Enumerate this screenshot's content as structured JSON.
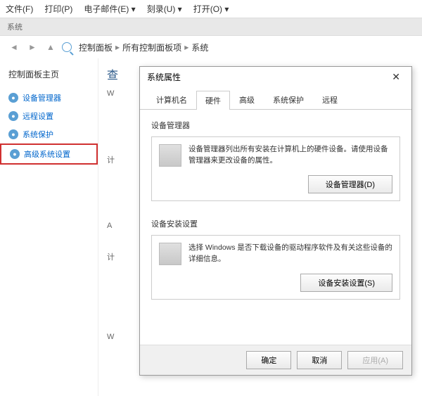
{
  "menubar": {
    "file": "文件(F)",
    "print": "打印(P)",
    "email": "电子邮件(E) ▾",
    "record": "刻录(U) ▾",
    "open": "打开(O) ▾"
  },
  "titlebar": "系统",
  "breadcrumb": {
    "item1": "控制面板",
    "item2": "所有控制面板项",
    "item3": "系统"
  },
  "sidebar": {
    "title": "控制面板主页",
    "items": [
      {
        "label": "设备管理器"
      },
      {
        "label": "远程设置"
      },
      {
        "label": "系统保护"
      },
      {
        "label": "高级系统设置"
      }
    ]
  },
  "content": {
    "title": "查",
    "lines": [
      "W",
      "计",
      "A",
      "计",
      "W"
    ]
  },
  "dialog": {
    "title": "系统属性",
    "tabs": {
      "computer_name": "计算机名",
      "hardware": "硬件",
      "advanced": "高级",
      "system_protection": "系统保护",
      "remote": "远程"
    },
    "device_manager": {
      "title": "设备管理器",
      "text": "设备管理器列出所有安装在计算机上的硬件设备。请使用设备管理器来更改设备的属性。",
      "button": "设备管理器(D)"
    },
    "device_install": {
      "title": "设备安装设置",
      "text": "选择 Windows 是否下载设备的驱动程序软件及有关这些设备的详细信息。",
      "button": "设备安装设置(S)"
    },
    "footer": {
      "ok": "确定",
      "cancel": "取消",
      "apply": "应用(A)"
    }
  }
}
